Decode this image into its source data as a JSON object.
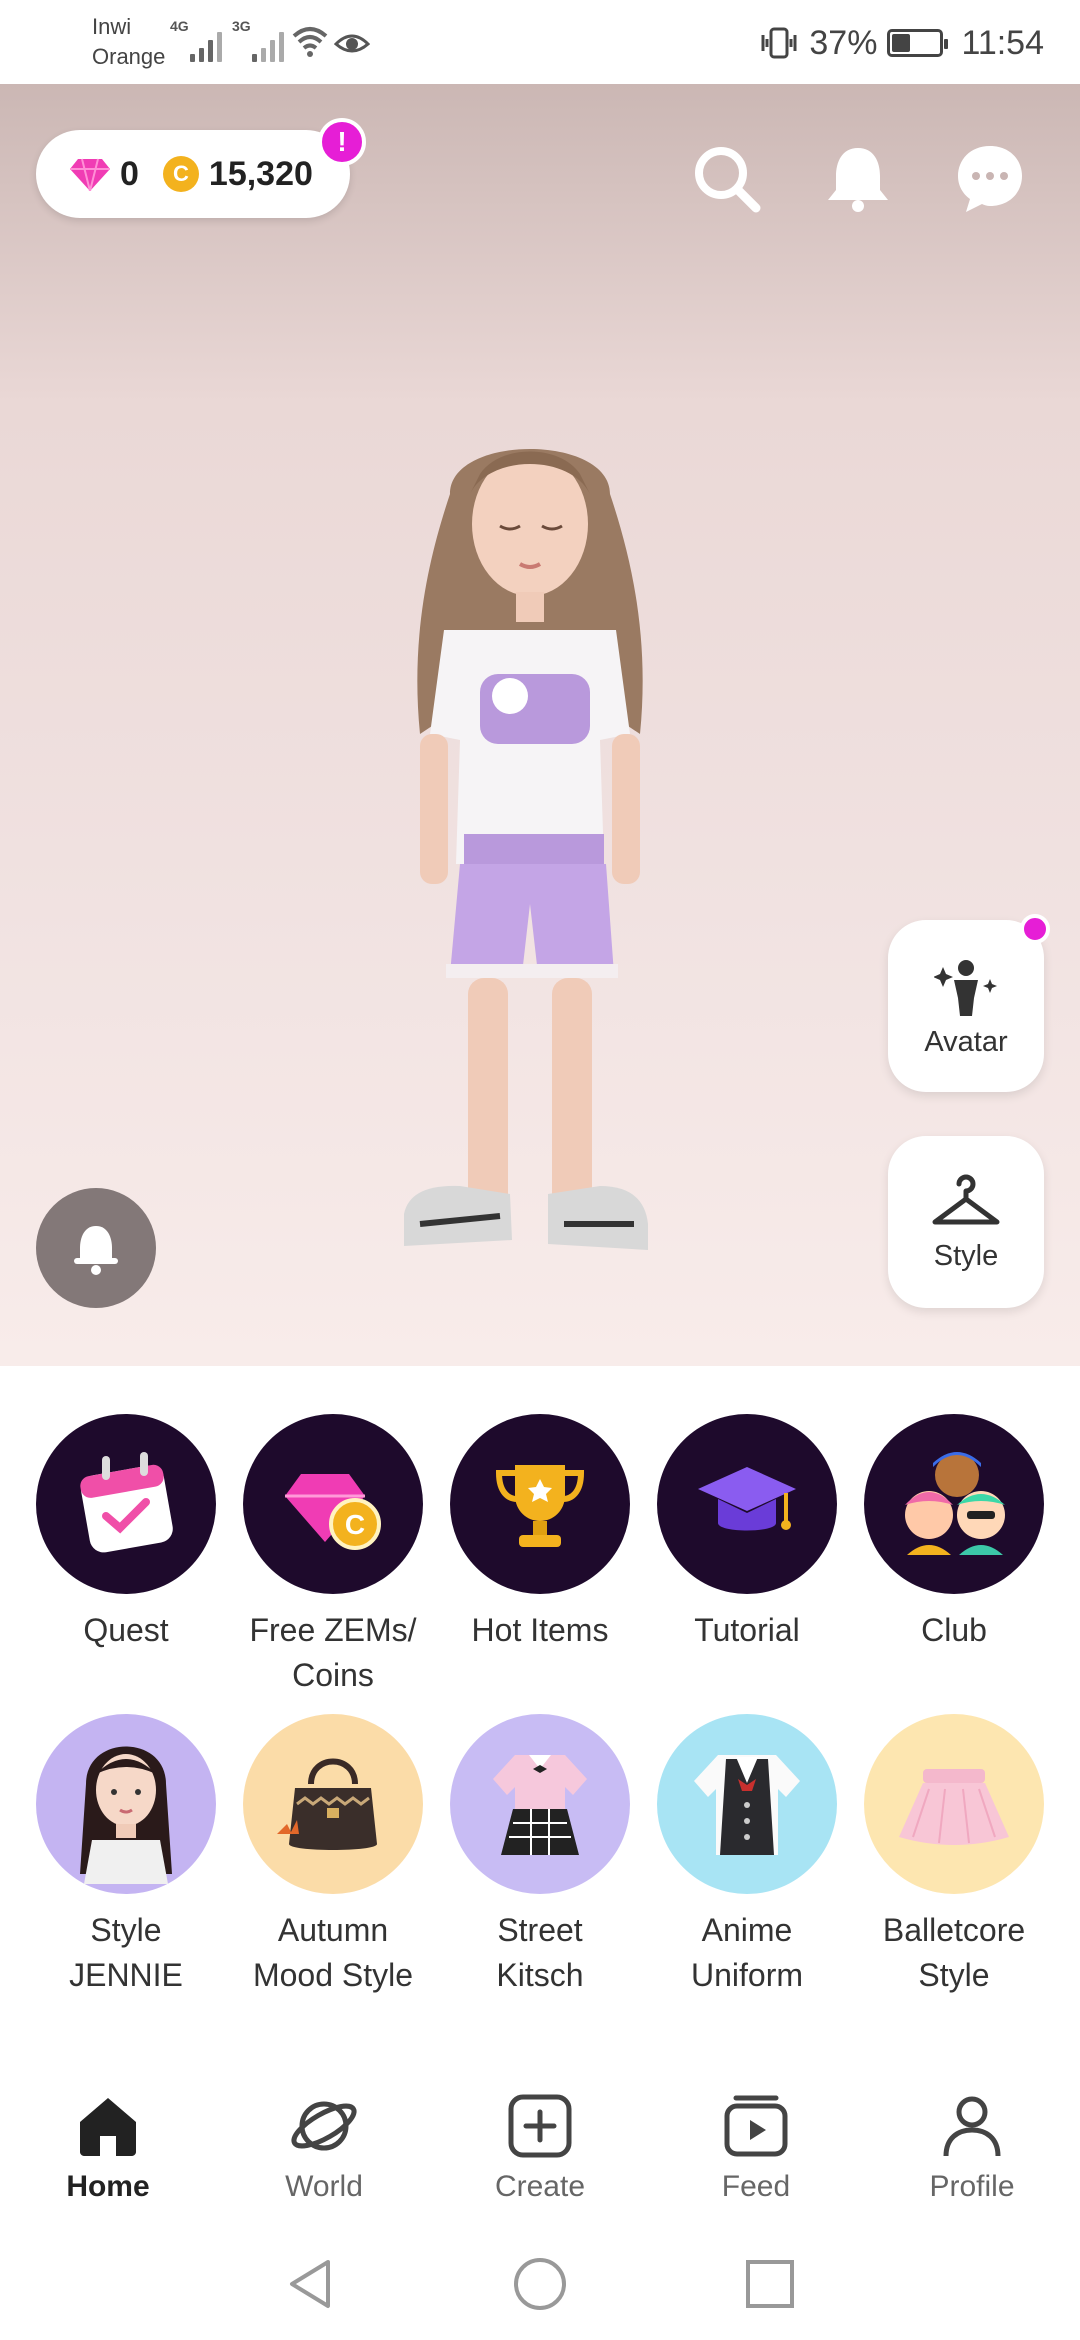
{
  "status_bar": {
    "carrier_line1": "Inwi",
    "carrier_line2": "Orange",
    "net1": "4G",
    "net2": "3G",
    "battery": "37%",
    "time": "11:54"
  },
  "currency": {
    "zems": "0",
    "coins": "15,320",
    "coin_symbol": "C",
    "alert": "!"
  },
  "side_buttons": {
    "avatar": "Avatar",
    "style": "Style"
  },
  "quick_row1": [
    {
      "label": "Quest",
      "icon": "calendar-check-icon"
    },
    {
      "label": "Free ZEMs/\nCoins",
      "icon": "gem-coin-icon"
    },
    {
      "label": "Hot Items",
      "icon": "trophy-icon"
    },
    {
      "label": "Tutorial",
      "icon": "graduation-cap-icon"
    },
    {
      "label": "Club",
      "icon": "group-avatars-icon"
    }
  ],
  "quick_row2": [
    {
      "label": "Style\nJENNIE",
      "icon": "jennie-avatar-icon"
    },
    {
      "label": "Autumn\nMood Style",
      "icon": "handbag-icon"
    },
    {
      "label": "Street\nKitsch",
      "icon": "outfit-icon"
    },
    {
      "label": "Anime\nUniform",
      "icon": "uniform-icon"
    },
    {
      "label": "Balletcore\nStyle",
      "icon": "tutu-skirt-icon"
    }
  ],
  "bottom_nav": {
    "home": "Home",
    "world": "World",
    "create": "Create",
    "feed": "Feed",
    "profile": "Profile"
  },
  "colors": {
    "accent": "#e61ed6",
    "dark_circle": "#1e0a2c",
    "coin": "#f3b21e"
  }
}
